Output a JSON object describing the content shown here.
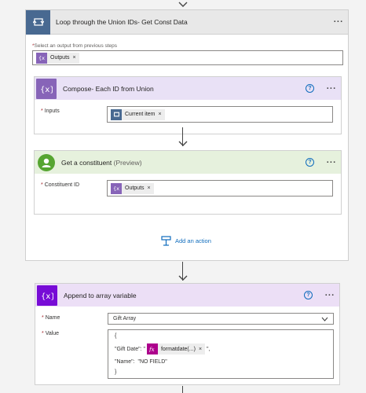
{
  "scope": {
    "title": "Loop through the Union IDs- Get Const Data",
    "more_label": "···",
    "select_output": {
      "required_mark": "*",
      "label": "Select an output from previous steps",
      "token": "Outputs",
      "token_remove": "×"
    }
  },
  "compose": {
    "title": "Compose- Each ID from Union",
    "help": "?",
    "more_label": "···",
    "inputs": {
      "required_mark": "*",
      "label": "Inputs",
      "token": "Current item",
      "token_remove": "×"
    },
    "accent": "#8764b8",
    "header_bg": "#e9e1f6"
  },
  "constituent": {
    "title": "Get a constituent",
    "title_suffix": "(Preview)",
    "help": "?",
    "more_label": "···",
    "field": {
      "required_mark": "*",
      "label": "Constituent ID",
      "token": "Outputs",
      "token_remove": "×"
    },
    "accent": "#56a531",
    "header_bg": "#e6f1dd"
  },
  "add_action": {
    "label": "Add an action"
  },
  "append": {
    "title": "Append to array variable",
    "help": "?",
    "more_label": "···",
    "name": {
      "required_mark": "*",
      "label": "Name",
      "value": "Gift Array"
    },
    "value": {
      "required_mark": "*",
      "label": "Value",
      "line1": "{",
      "gift_key": "\"Gift Date\": \"",
      "expr_token": "formatdate(...)",
      "token_remove": "×",
      "gift_tail": "\",",
      "name_line": "\"Name\":  \"NO FIELD\"",
      "line_close": "}"
    },
    "accent": "#770bd6",
    "header_bg": "#ecdff6"
  }
}
